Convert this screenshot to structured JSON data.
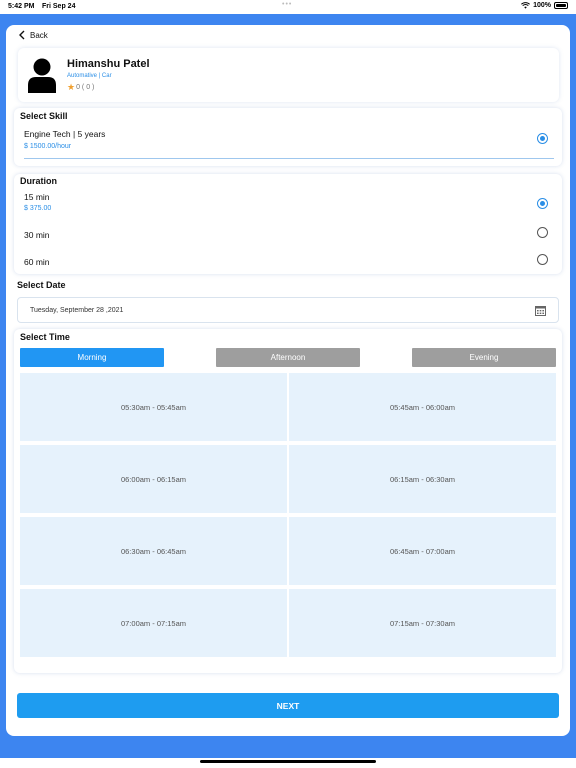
{
  "status_bar": {
    "time": "5:42 PM",
    "date": "Fri Sep 24",
    "battery": "100%"
  },
  "nav": {
    "back_label": "Back"
  },
  "profile": {
    "name": "Himanshu Patel",
    "category": "Automative | Car",
    "rating": "0 ( 0 )"
  },
  "skill": {
    "title": "Select Skill",
    "name": "Engine Tech  | 5 years",
    "price": "$ 1500.00/hour",
    "selected": true
  },
  "duration": {
    "title": "Duration",
    "options": [
      {
        "label": "15 min",
        "price": "$ 375.00",
        "selected": true
      },
      {
        "label": "30 min",
        "selected": false
      },
      {
        "label": "60 min",
        "selected": false
      }
    ]
  },
  "date": {
    "title": "Select Date",
    "value": "Tuesday, September 28 ,2021",
    "icon": "calendar-icon"
  },
  "time": {
    "title": "Select Time",
    "tabs": [
      {
        "label": "Morning",
        "active": true
      },
      {
        "label": "Afternoon",
        "active": false
      },
      {
        "label": "Evening",
        "active": false
      }
    ],
    "slots": [
      "05:30am - 05:45am",
      "05:45am - 06:00am",
      "06:00am - 06:15am",
      "06:15am - 06:30am",
      "06:30am - 06:45am",
      "06:45am - 07:00am",
      "07:00am - 07:15am",
      "07:15am - 07:30am"
    ]
  },
  "next_label": "NEXT",
  "colors": {
    "frame": "#3d85f0",
    "accent": "#2196f3",
    "inactive_tab": "#9e9e9e",
    "slot_bg": "#e6f2fc",
    "price": "#2a8ee6"
  }
}
